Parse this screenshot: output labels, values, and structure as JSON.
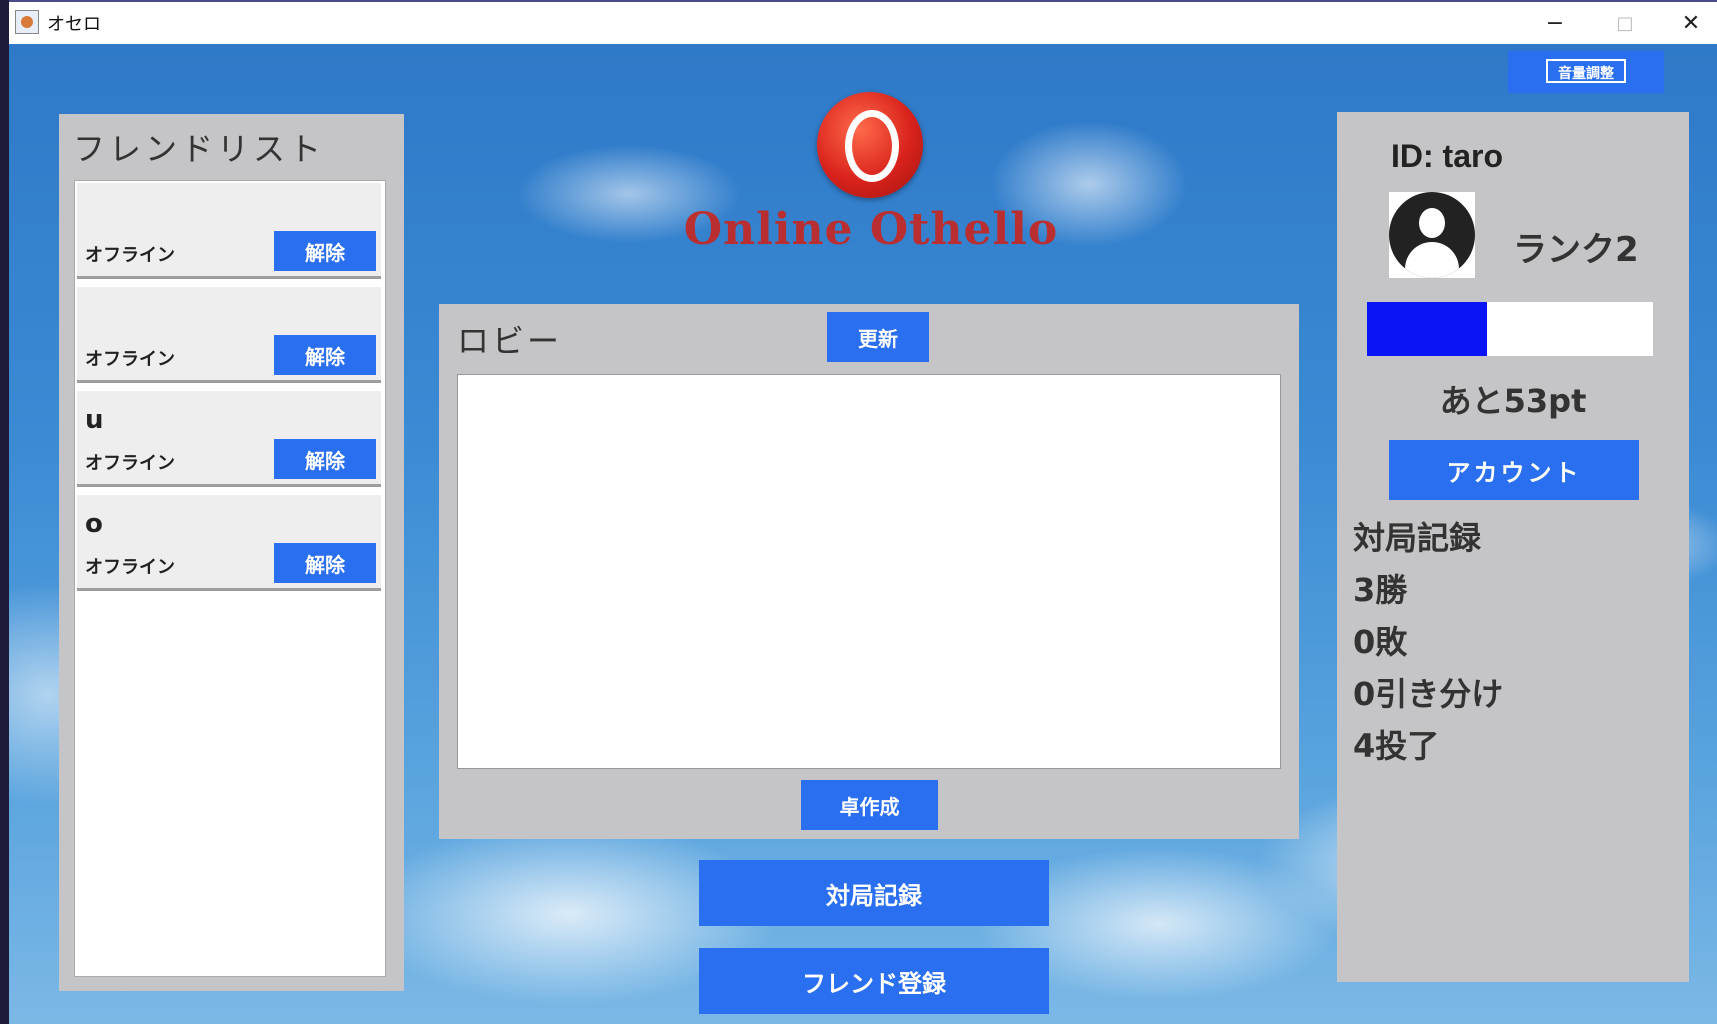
{
  "window": {
    "title": "オセロ",
    "minimize": "−",
    "maximize": "□",
    "close": "✕"
  },
  "logo": {
    "text": "Online Othello",
    "icon": "othello-logo-icon"
  },
  "volume_button": {
    "label": "音量調整"
  },
  "friend_list": {
    "title": "フレンドリスト",
    "items": [
      {
        "name": "",
        "status": "オフライン",
        "remove_label": "解除"
      },
      {
        "name": "",
        "status": "オフライン",
        "remove_label": "解除"
      },
      {
        "name": "u",
        "status": "オフライン",
        "remove_label": "解除"
      },
      {
        "name": "o",
        "status": "オフライン",
        "remove_label": "解除"
      }
    ]
  },
  "lobby": {
    "title": "ロビー",
    "refresh_label": "更新",
    "create_table_label": "卓作成"
  },
  "bottom_buttons": {
    "match_record": "対局記録",
    "friend_register": "フレンド登録"
  },
  "profile": {
    "id": "ID: taro",
    "avatar_icon": "user-avatar-icon",
    "rank": "ランク2",
    "progress_fraction": 0.42,
    "progress_color": "#0a14f5",
    "remaining": "あと53pt",
    "account_label": "アカウント",
    "stats": {
      "title": "対局記録",
      "wins": "3勝",
      "losses": "0敗",
      "draws": "0引き分け",
      "resigns": "4投了"
    }
  },
  "colors": {
    "button_blue": "#2a6ff0",
    "panel_gray": "#c5c4c6"
  }
}
